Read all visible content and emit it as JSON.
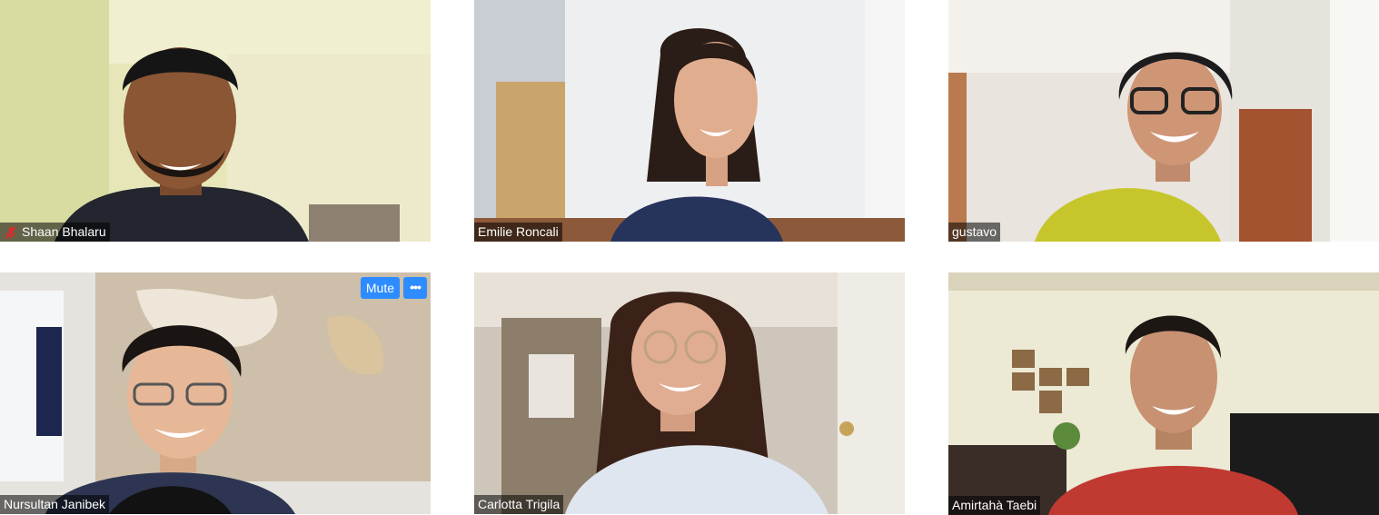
{
  "app": "video-meeting-gallery-view",
  "participants": [
    {
      "name": "Shaan Bhalaru",
      "muted": true,
      "video_description": "smiling man with dark hair and beard, earphones, yellow-green room"
    },
    {
      "name": "Emilie Roncali",
      "muted": false,
      "video_description": "smiling woman with long dark hair, white closet doors behind"
    },
    {
      "name": "gustavo",
      "muted": false,
      "video_description": "smiling man with glasses and black beanie, yellow jacket"
    },
    {
      "name": "Nursultan Janibek",
      "muted": false,
      "video_description": "smiling young man with glasses, world map on wall"
    },
    {
      "name": "Carlotta Trigila",
      "muted": false,
      "video_description": "smiling woman with glasses and light blue shirt"
    },
    {
      "name": "Amirtahà Taebi",
      "muted": false,
      "video_description": "smiling man in red t-shirt, living room with pictures"
    }
  ],
  "hover_controls": {
    "mute_label": "Mute",
    "more_label": "•••"
  },
  "colors": {
    "accent": "#2d8cff",
    "muted_icon": "#e02828",
    "name_tag_bg": "rgba(0,0,0,0.55)"
  },
  "icons": {
    "muted": "microphone-off-icon",
    "more": "ellipsis-icon"
  }
}
